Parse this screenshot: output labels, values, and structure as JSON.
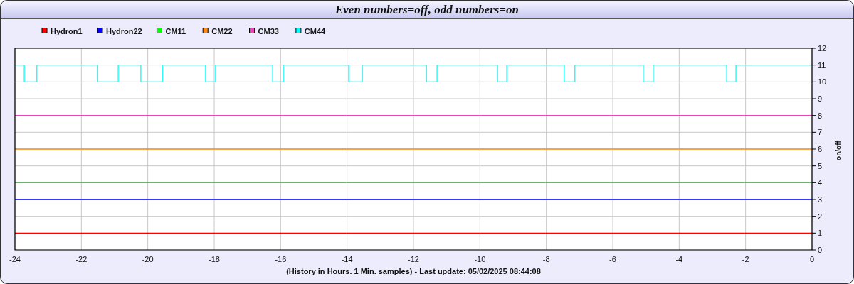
{
  "title": "Even numbers=off, odd numbers=on",
  "chart": {
    "chart_data": {
      "type": "line",
      "xlabel": "(History in Hours. 1 Min. samples) - Last update: 05/02/2025 08:44:08",
      "ylabel": "on/off",
      "grid": true,
      "legend": true,
      "xlim": [
        -24,
        0
      ],
      "ylim": [
        0,
        12
      ],
      "xticks": [
        -24,
        -22,
        -20,
        -18,
        -16,
        -14,
        -12,
        -10,
        -8,
        -6,
        -4,
        -2,
        0
      ],
      "yticks": [
        0,
        1,
        2,
        3,
        4,
        5,
        6,
        7,
        8,
        9,
        10,
        11,
        12
      ],
      "x": [
        -24,
        -23.72,
        -23.72,
        -23.34,
        -23.34,
        -21.51,
        -21.51,
        -20.89,
        -20.89,
        -20.21,
        -20.21,
        -19.56,
        -19.56,
        -18.26,
        -18.26,
        -17.96,
        -17.96,
        -16.24,
        -16.24,
        -15.92,
        -15.92,
        -13.95,
        -13.95,
        -13.54,
        -13.54,
        -11.61,
        -11.61,
        -11.29,
        -11.29,
        -9.47,
        -9.47,
        -9.19,
        -9.19,
        -7.46,
        -7.46,
        -7.14,
        -7.14,
        -5.08,
        -5.08,
        -4.78,
        -4.78,
        -2.57,
        -2.57,
        -2.29,
        -2.29,
        0
      ],
      "series": [
        {
          "name": "Hydron1",
          "color": "#ff0000",
          "values": [
            1,
            1,
            1,
            1,
            1,
            1,
            1,
            1,
            1,
            1,
            1,
            1,
            1,
            1,
            1,
            1,
            1,
            1,
            1,
            1,
            1,
            1,
            1,
            1,
            1,
            1,
            1,
            1,
            1,
            1,
            1,
            1,
            1,
            1,
            1,
            1,
            1,
            1,
            1,
            1,
            1,
            1,
            1,
            1,
            1,
            1
          ]
        },
        {
          "name": "Hydron22",
          "color": "#0000ff",
          "values": [
            3,
            3,
            3,
            3,
            3,
            3,
            3,
            3,
            3,
            3,
            3,
            3,
            3,
            3,
            3,
            3,
            3,
            3,
            3,
            3,
            3,
            3,
            3,
            3,
            3,
            3,
            3,
            3,
            3,
            3,
            3,
            3,
            3,
            3,
            3,
            3,
            3,
            3,
            3,
            3,
            3,
            3,
            3,
            3,
            3,
            3
          ]
        },
        {
          "name": "CM11",
          "color": "#00ff00",
          "values": [
            4,
            4,
            4,
            4,
            4,
            4,
            4,
            4,
            4,
            4,
            4,
            4,
            4,
            4,
            4,
            4,
            4,
            4,
            4,
            4,
            4,
            4,
            4,
            4,
            4,
            4,
            4,
            4,
            4,
            4,
            4,
            4,
            4,
            4,
            4,
            4,
            4,
            4,
            4,
            4,
            4,
            4,
            4,
            4,
            4,
            4
          ]
        },
        {
          "name": "CM22",
          "color": "#ff8c1a",
          "values": [
            6,
            6,
            6,
            6,
            6,
            6,
            6,
            6,
            6,
            6,
            6,
            6,
            6,
            6,
            6,
            6,
            6,
            6,
            6,
            6,
            6,
            6,
            6,
            6,
            6,
            6,
            6,
            6,
            6,
            6,
            6,
            6,
            6,
            6,
            6,
            6,
            6,
            6,
            6,
            6,
            6,
            6,
            6,
            6,
            6,
            6
          ]
        },
        {
          "name": "CM33",
          "color": "#ee44bb",
          "values": [
            8,
            8,
            8,
            8,
            8,
            8,
            8,
            8,
            8,
            8,
            8,
            8,
            8,
            8,
            8,
            8,
            8,
            8,
            8,
            8,
            8,
            8,
            8,
            8,
            8,
            8,
            8,
            8,
            8,
            8,
            8,
            8,
            8,
            8,
            8,
            8,
            8,
            8,
            8,
            8,
            8,
            8,
            8,
            8,
            8,
            8
          ]
        },
        {
          "name": "CM44",
          "color": "#00ffff",
          "values": [
            11,
            11,
            10,
            10,
            11,
            11,
            10,
            10,
            11,
            11,
            10,
            10,
            11,
            11,
            10,
            10,
            11,
            11,
            10,
            10,
            11,
            11,
            10,
            10,
            11,
            11,
            10,
            10,
            11,
            11,
            10,
            10,
            11,
            11,
            10,
            10,
            11,
            11,
            10,
            10,
            11,
            11,
            10,
            10,
            11,
            11
          ]
        }
      ]
    }
  }
}
